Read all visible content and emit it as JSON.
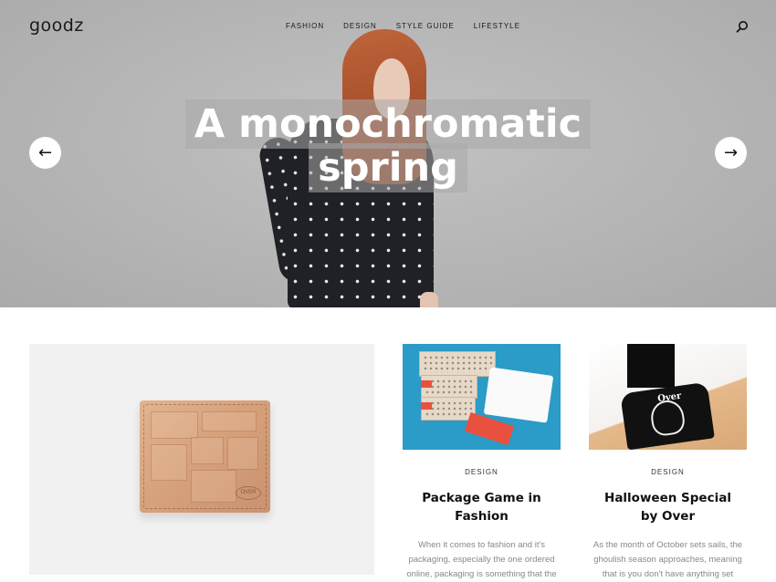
{
  "header": {
    "logo": "goodz",
    "nav": [
      "FASHION",
      "DESIGN",
      "STYLE GUIDE",
      "LIFESTYLE"
    ]
  },
  "hero": {
    "headline_line1": "A monochromatic",
    "headline_line2": "spring",
    "prev_arrow": "←",
    "next_arrow": "→"
  },
  "feature": {
    "stamp": "OVER"
  },
  "posts": [
    {
      "category": "DESIGN",
      "title": "Package Game in Fashion",
      "excerpt": "When it comes to fashion and it's packaging, especially the one ordered online, packaging is something that the brands, new and upcoming, as well as"
    },
    {
      "category": "DESIGN",
      "title_line1": "Halloween Special",
      "title_line2": "by Over",
      "excerpt": "As the month of October sets sails, the ghoulish season approaches, meaning that is you don't have anything set",
      "shirt_text": "Over"
    }
  ],
  "colors": {
    "hero_bg": "#b5b5b5",
    "accent_blue": "#2b9bc7",
    "text_dark": "#111111",
    "text_muted": "#888888"
  },
  "icons": [
    "search-icon",
    "arrow-left-icon",
    "arrow-right-icon"
  ]
}
